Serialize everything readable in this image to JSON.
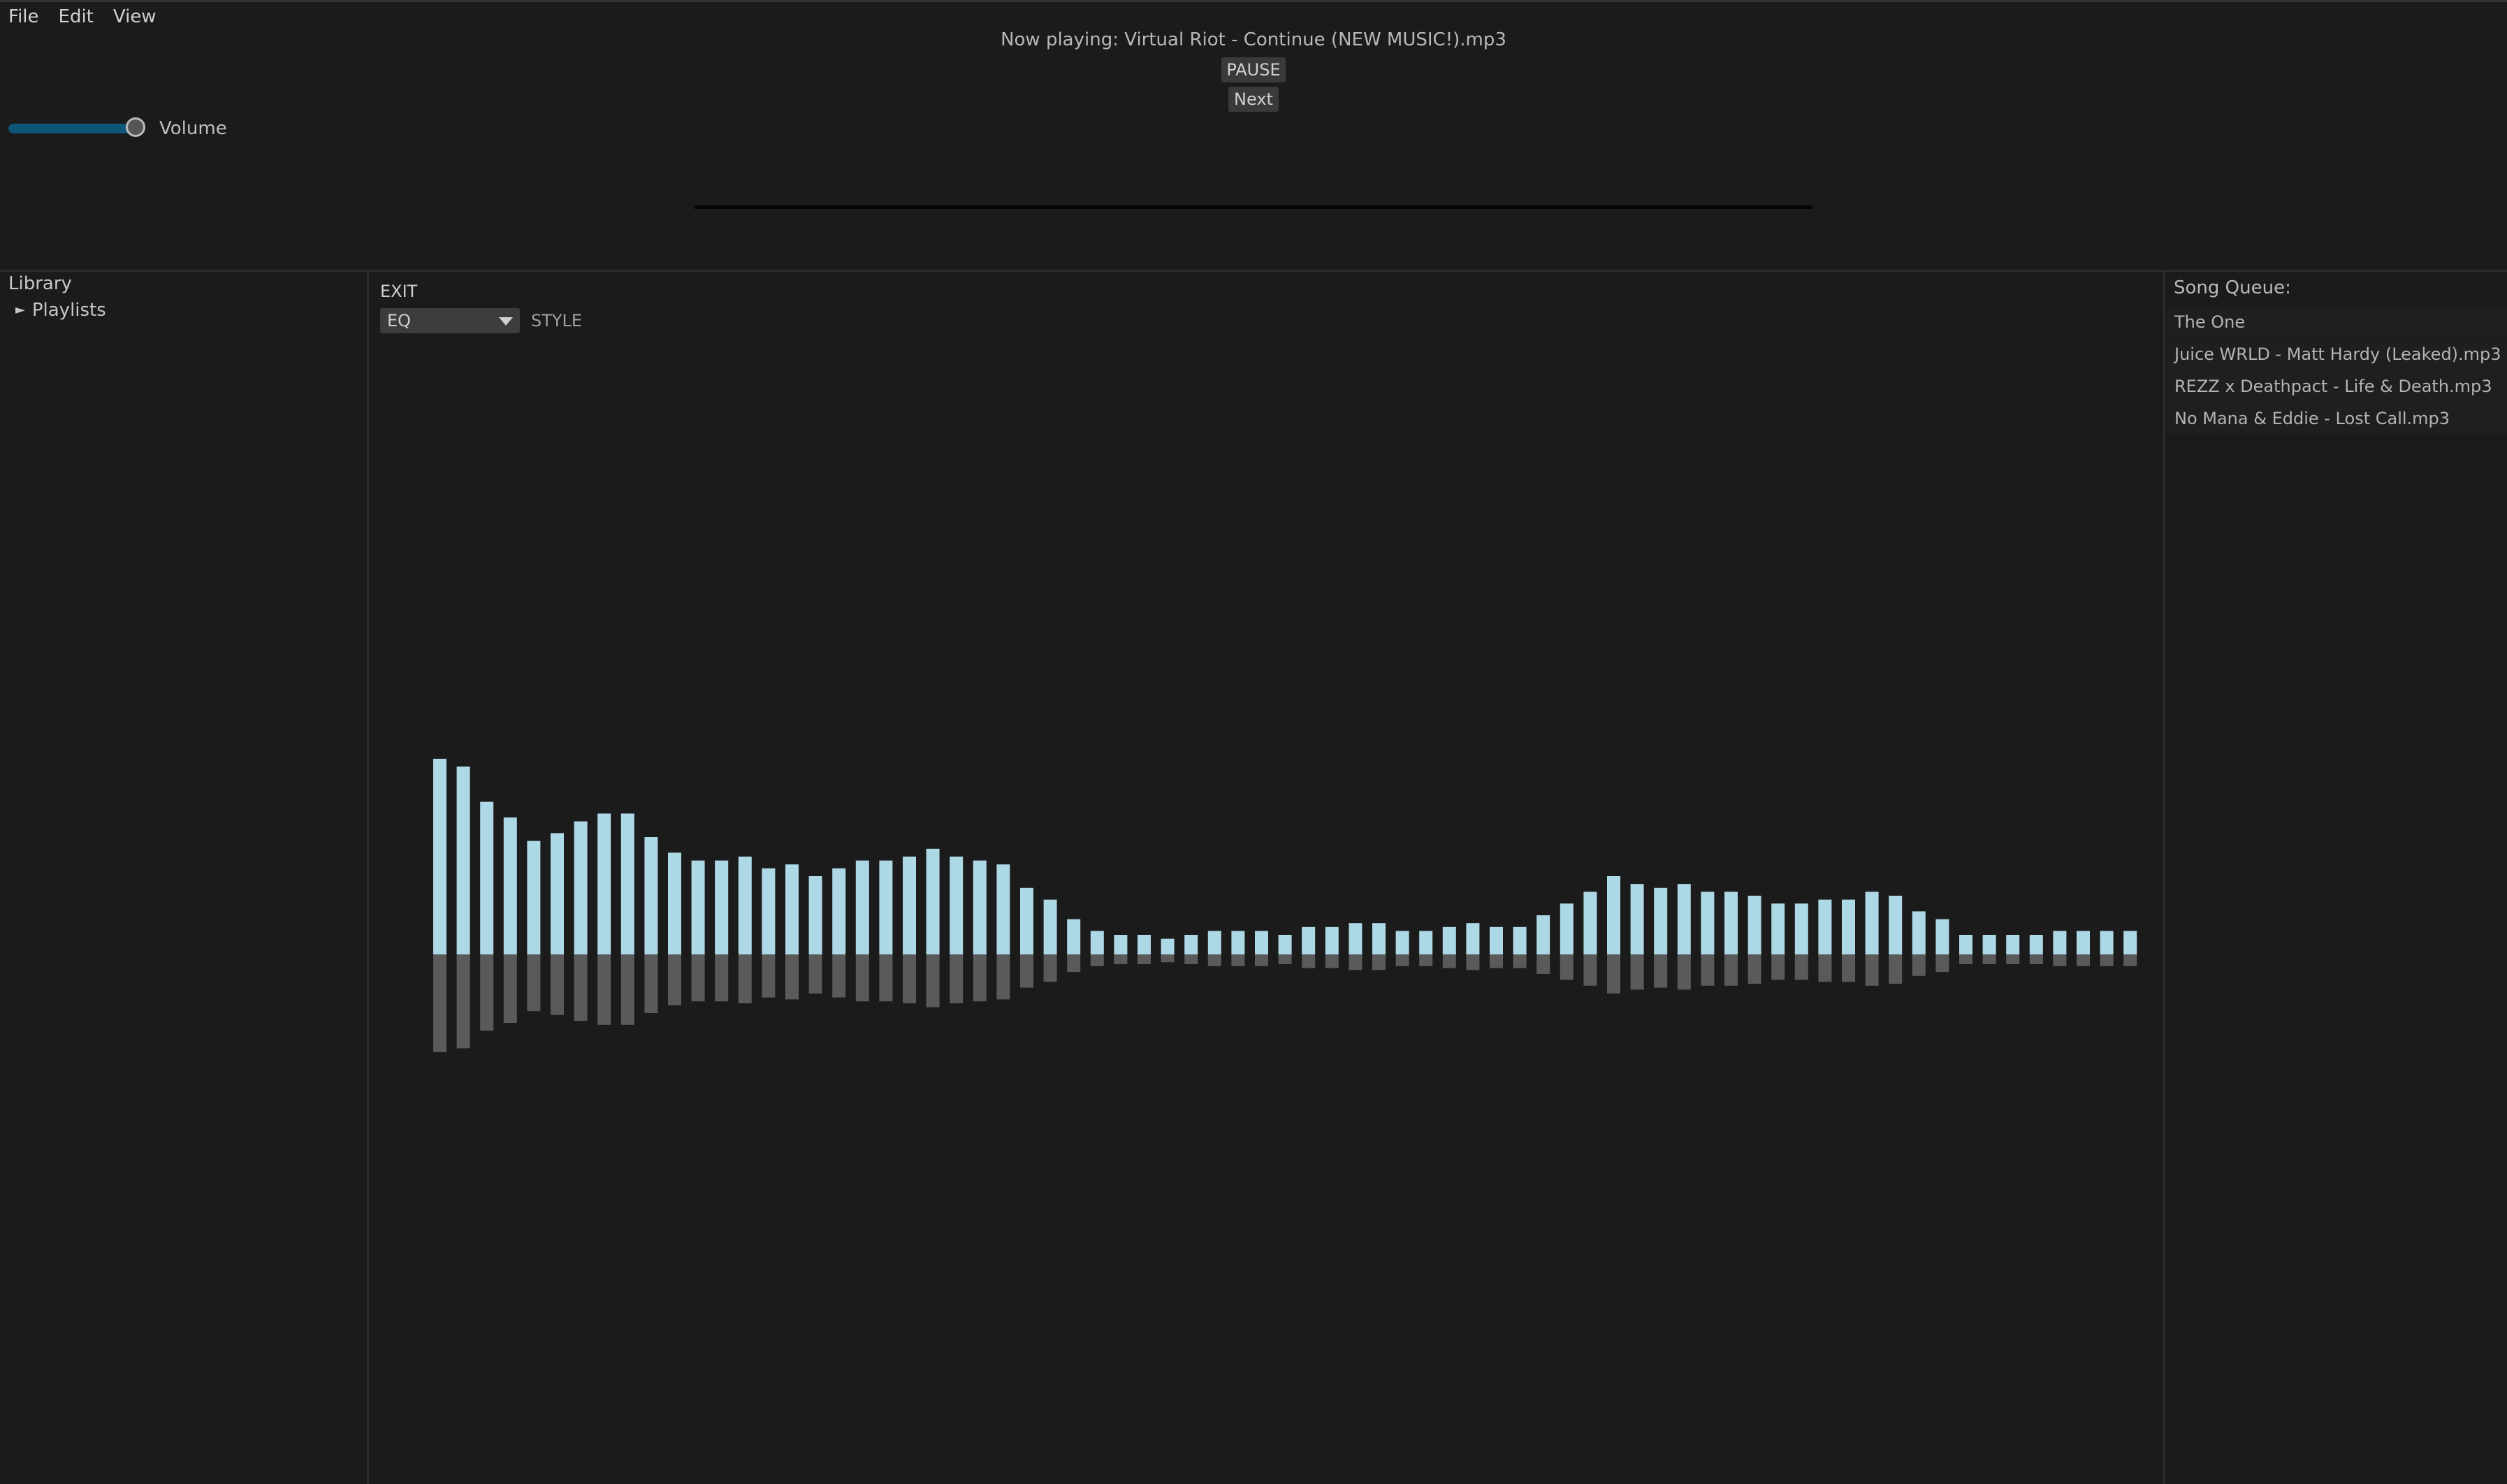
{
  "menu": [
    "File",
    "Edit",
    "View"
  ],
  "player": {
    "now_playing": "Now playing: Virtual Riot - Continue (NEW MUSIC!).mp3",
    "pause_label": "PAUSE",
    "next_label": "Next",
    "volume_label": "Volume",
    "volume_level": 0.9
  },
  "library": {
    "title": "Library",
    "items": [
      {
        "label": "Playlists"
      }
    ]
  },
  "visualizer": {
    "exit_label": "EXIT",
    "mode_value": "EQ",
    "style_label": "STYLE",
    "bar_color": "#add8e6",
    "reflection_color": "#5a5a5a",
    "levels": [
      0.5,
      0.48,
      0.39,
      0.35,
      0.29,
      0.31,
      0.34,
      0.36,
      0.36,
      0.3,
      0.26,
      0.24,
      0.24,
      0.25,
      0.22,
      0.23,
      0.2,
      0.22,
      0.24,
      0.24,
      0.25,
      0.27,
      0.25,
      0.24,
      0.23,
      0.17,
      0.14,
      0.09,
      0.06,
      0.05,
      0.05,
      0.04,
      0.05,
      0.06,
      0.06,
      0.06,
      0.05,
      0.07,
      0.07,
      0.08,
      0.08,
      0.06,
      0.06,
      0.07,
      0.08,
      0.07,
      0.07,
      0.1,
      0.13,
      0.16,
      0.2,
      0.18,
      0.17,
      0.18,
      0.16,
      0.16,
      0.15,
      0.13,
      0.13,
      0.14,
      0.14,
      0.16,
      0.15,
      0.11,
      0.09,
      0.05,
      0.05,
      0.05,
      0.05,
      0.06,
      0.06,
      0.06,
      0.06
    ]
  },
  "queue": {
    "title": "Song Queue:",
    "items": [
      "The One",
      "Juice WRLD - Matt Hardy (Leaked).mp3",
      "REZZ x Deathpact - Life & Death.mp3",
      "No Mana & Eddie - Lost Call.mp3"
    ]
  }
}
